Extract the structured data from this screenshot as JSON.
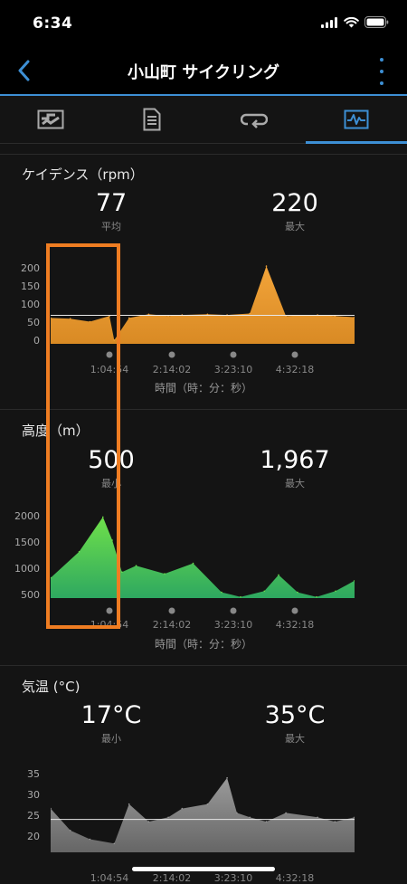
{
  "status": {
    "time": "6:34"
  },
  "nav": {
    "title": "小山町 サイクリング"
  },
  "tabs": [
    {
      "name": "map-tab",
      "icon": "map-icon"
    },
    {
      "name": "details-tab",
      "icon": "document-icon"
    },
    {
      "name": "laps-tab",
      "icon": "loop-icon"
    },
    {
      "name": "charts-tab",
      "icon": "chart-icon",
      "active": true
    }
  ],
  "cadence": {
    "title": "ケイデンス（rpm）",
    "avg_value": "77",
    "avg_label": "平均",
    "max_value": "220",
    "max_label": "最大",
    "y_ticks": [
      "200",
      "150",
      "100",
      "50",
      "0"
    ],
    "x_ticks": [
      "1:04:54",
      "2:14:02",
      "3:23:10",
      "4:32:18"
    ],
    "x_caption": "時間（時：分：秒）"
  },
  "elevation": {
    "title": "高度（m）",
    "min_value": "500",
    "min_label": "最小",
    "max_value": "1,967",
    "max_label": "最大",
    "y_ticks": [
      "2000",
      "1500",
      "1000",
      "500"
    ],
    "x_ticks": [
      "1:04:54",
      "2:14:02",
      "3:23:10",
      "4:32:18"
    ],
    "x_caption": "時間（時：分：秒）"
  },
  "temperature": {
    "title": "気温 (°C)",
    "min_value": "17°C",
    "min_label": "最小",
    "max_value": "35°C",
    "max_label": "最大",
    "y_ticks": [
      "35",
      "30",
      "25",
      "20"
    ],
    "x_ticks": [
      "1:04:54",
      "2:14:02",
      "3:23:10",
      "4:32:18"
    ]
  },
  "chart_data": [
    {
      "type": "area",
      "title": "ケイデンス（rpm）",
      "xlabel": "時間（時：分：秒）",
      "ylabel": "",
      "ylim": [
        0,
        220
      ],
      "x": [
        "0:00:00",
        "0:20:00",
        "0:40:00",
        "1:00:00",
        "1:04:54",
        "1:20:00",
        "1:40:00",
        "2:00:00",
        "2:14:02",
        "2:40:00",
        "3:00:00",
        "3:23:10",
        "3:40:00",
        "4:00:00",
        "4:32:18",
        "4:50:00",
        "5:10:00"
      ],
      "series": [
        {
          "values": [
            70,
            68,
            60,
            75,
            10,
            70,
            80,
            75,
            78,
            80,
            78,
            82,
            210,
            75,
            78,
            75,
            72
          ]
        }
      ],
      "average": 77,
      "max": 220,
      "color": "#f0a030"
    },
    {
      "type": "area",
      "title": "高度（m）",
      "xlabel": "時間（時：分：秒）",
      "ylabel": "",
      "ylim": [
        500,
        2000
      ],
      "x": [
        "0:00:00",
        "0:30:00",
        "0:55:00",
        "1:04:54",
        "1:15:00",
        "1:30:00",
        "2:00:00",
        "2:30:00",
        "3:00:00",
        "3:20:00",
        "3:45:00",
        "4:00:00",
        "4:20:00",
        "4:40:00",
        "5:00:00",
        "5:20:00"
      ],
      "series": [
        {
          "values": [
            850,
            1300,
            1900,
            1500,
            950,
            1060,
            920,
            1100,
            600,
            520,
            620,
            900,
            600,
            520,
            620,
            800
          ]
        }
      ],
      "min": 500,
      "max": 1967,
      "color": "#4ed04a"
    },
    {
      "type": "area",
      "title": "気温 (°C)",
      "xlabel": "",
      "ylabel": "",
      "ylim": [
        17,
        36
      ],
      "x": [
        "0:00:00",
        "0:20:00",
        "0:40:00",
        "1:04:54",
        "1:20:00",
        "1:40:00",
        "2:00:00",
        "2:14:02",
        "2:40:00",
        "3:00:00",
        "3:10:00",
        "3:23:10",
        "3:40:00",
        "4:00:00",
        "4:32:18",
        "4:50:00",
        "5:10:00"
      ],
      "series": [
        {
          "values": [
            27,
            22,
            20,
            19,
            28,
            24,
            25,
            27,
            28,
            34,
            26,
            25,
            24,
            26,
            25,
            24,
            25
          ]
        }
      ],
      "min": 17,
      "max": 35,
      "color": "#8a8a8a"
    }
  ]
}
